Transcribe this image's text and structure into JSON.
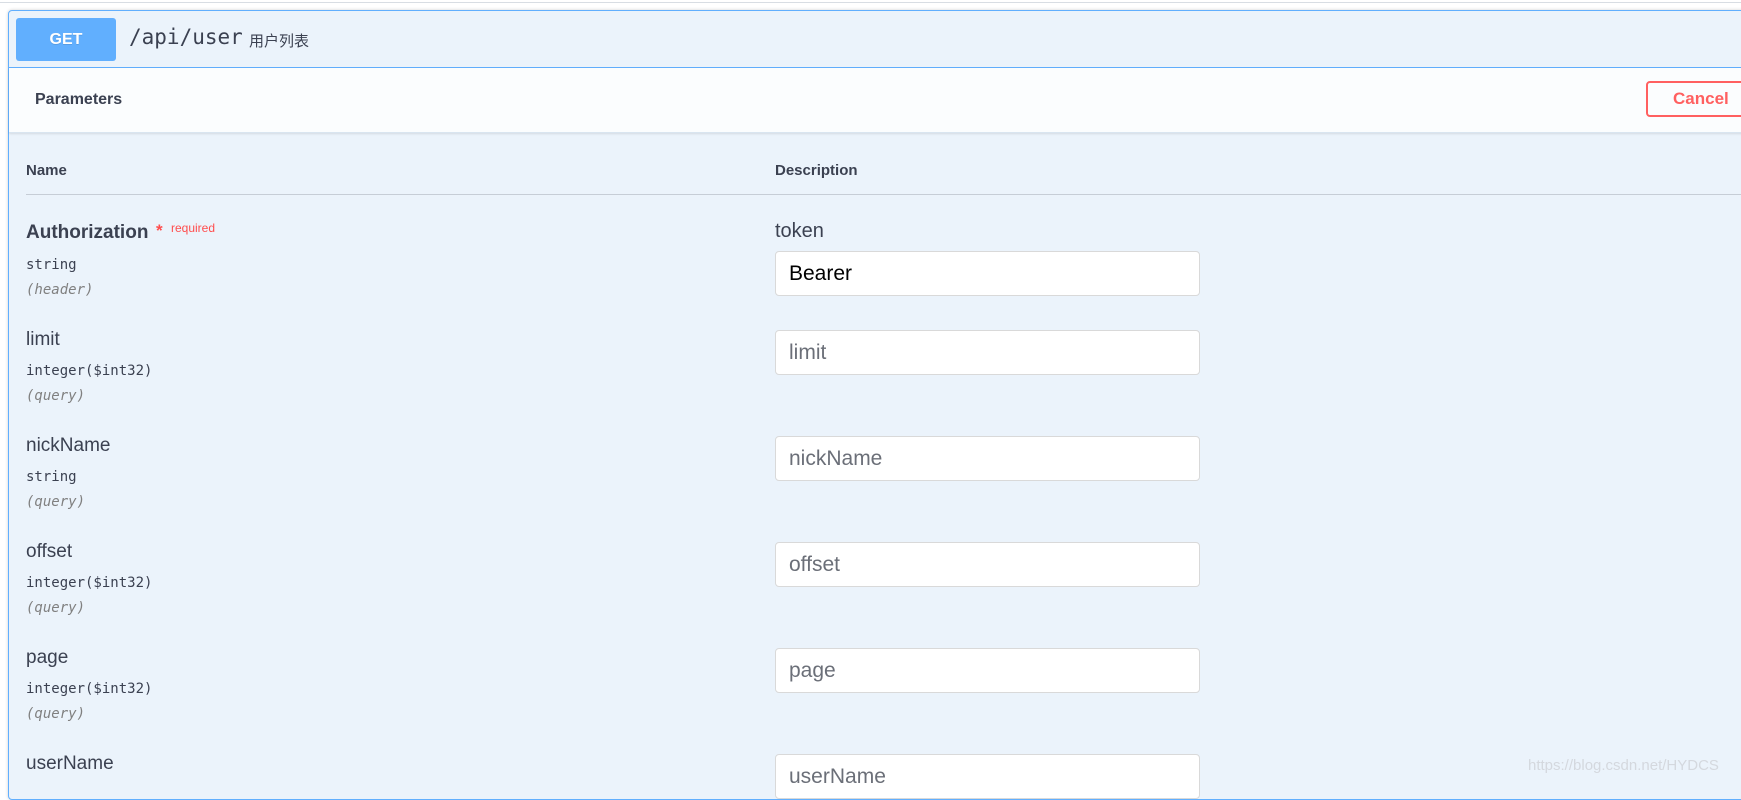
{
  "operation": {
    "method": "GET",
    "path": "/api/user",
    "summary": "用户列表"
  },
  "parameters_section": {
    "title": "Parameters",
    "cancel_label": "Cancel"
  },
  "table": {
    "col_name": "Name",
    "col_description": "Description"
  },
  "params": [
    {
      "name": "Authorization",
      "required_star": "*",
      "required_label": "required",
      "type": "string",
      "in": "(header)",
      "description": "token",
      "value": "Bearer",
      "placeholder": ""
    },
    {
      "name": "limit",
      "type": "integer($int32)",
      "in": "(query)",
      "value": "",
      "placeholder": "limit"
    },
    {
      "name": "nickName",
      "type": "string",
      "in": "(query)",
      "value": "",
      "placeholder": "nickName"
    },
    {
      "name": "offset",
      "type": "integer($int32)",
      "in": "(query)",
      "value": "",
      "placeholder": "offset"
    },
    {
      "name": "page",
      "type": "integer($int32)",
      "in": "(query)",
      "value": "",
      "placeholder": "page"
    },
    {
      "name": "userName",
      "type": "",
      "in": "",
      "value": "",
      "placeholder": "userName"
    }
  ],
  "watermark": "https://blog.csdn.net/HYDCS",
  "colors": {
    "get_accent": "#61affe",
    "block_bg": "#ebf3fb",
    "cancel_red": "#ff6060",
    "required_red": "#ff4d4d"
  }
}
